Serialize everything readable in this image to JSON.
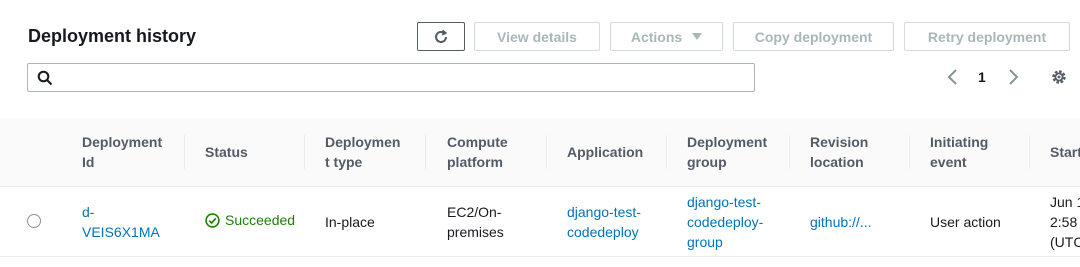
{
  "header": {
    "title": "Deployment history",
    "buttons": {
      "view_details": "View details",
      "actions": "Actions",
      "copy_deployment": "Copy deployment",
      "retry_deployment": "Retry deployment"
    }
  },
  "search": {
    "placeholder": "",
    "value": ""
  },
  "pagination": {
    "current_page": "1"
  },
  "table": {
    "columns": [
      [
        "Deployment",
        "Id"
      ],
      [
        "Status"
      ],
      [
        "Deploymen",
        "t type"
      ],
      [
        "Compute",
        "platform"
      ],
      [
        "Application"
      ],
      [
        "Deployment",
        "group"
      ],
      [
        "Revision",
        "location"
      ],
      [
        "Initiating",
        "event"
      ],
      [
        "Start"
      ]
    ],
    "rows": [
      {
        "deployment_id": [
          "d-",
          "VEIS6X1MA"
        ],
        "status": "Succeeded",
        "deployment_type": "In-place",
        "compute_platform": [
          "EC2/On-",
          "premises"
        ],
        "application": [
          "django-test-",
          "codedeploy"
        ],
        "deployment_group": [
          "django-test-",
          "codedeploy-",
          "group"
        ],
        "revision_location": "github://...",
        "initiating_event": "User action",
        "start": [
          "Jun 1",
          "2:58",
          "(UTC"
        ]
      }
    ]
  },
  "colors": {
    "accent": "#0073bb",
    "success": "#1d8102",
    "disabled": "#aab7b8"
  }
}
